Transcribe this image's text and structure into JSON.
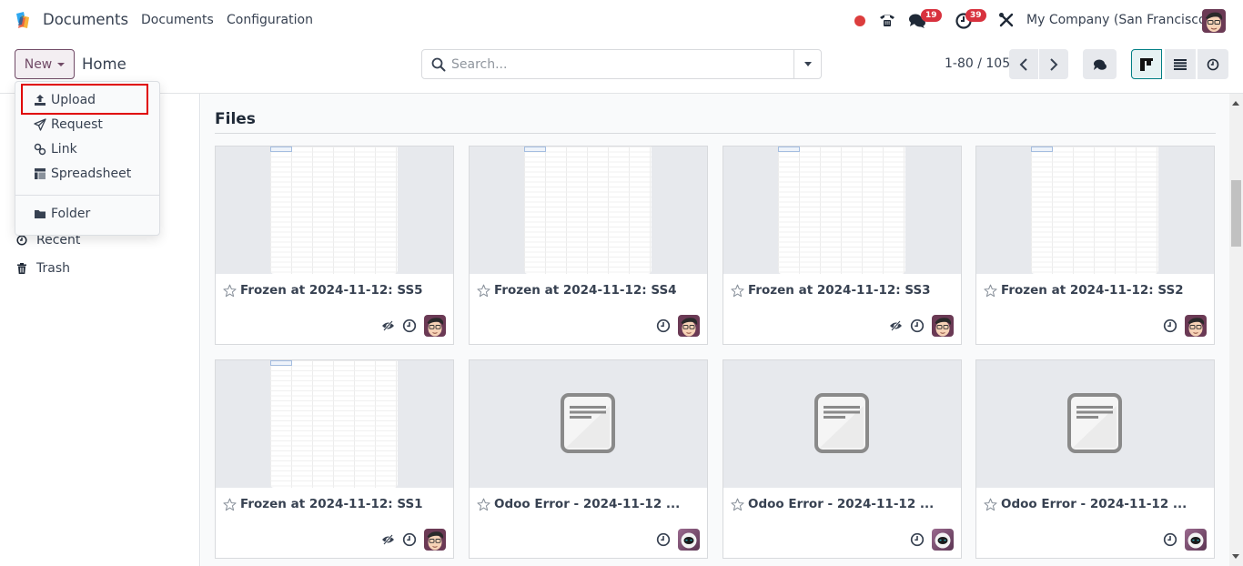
{
  "navbar": {
    "app_name": "Documents",
    "menu": [
      "Documents",
      "Configuration"
    ],
    "messages_badge": "19",
    "activities_badge": "39",
    "company": "My Company (San Francisco)",
    "icons": [
      "recording-dot-icon",
      "phone-icon",
      "chat-icon",
      "clock-icon",
      "tools-icon",
      "user-avatar"
    ]
  },
  "control_panel": {
    "new_button": "New",
    "breadcrumb": "Home",
    "search_placeholder": "Search...",
    "search_value": "",
    "pager": "1-80 / 105",
    "views": [
      "kanban",
      "list",
      "activity"
    ],
    "active_view": "kanban"
  },
  "new_dropdown": {
    "items": [
      {
        "label": "Upload",
        "icon": "upload-icon",
        "highlighted": true
      },
      {
        "label": "Request",
        "icon": "paper-plane-icon"
      },
      {
        "label": "Link",
        "icon": "link-icon"
      },
      {
        "label": "Spreadsheet",
        "icon": "spreadsheet-icon"
      },
      {
        "label": "Folder",
        "icon": "folder-icon"
      }
    ]
  },
  "sidebar": {
    "items": [
      {
        "label": "Recent",
        "icon": "clock-icon"
      },
      {
        "label": "Trash",
        "icon": "trash-icon"
      }
    ]
  },
  "main": {
    "section_title": "Files",
    "cards": [
      {
        "title": "Frozen at 2024-11-12: SS5",
        "preview": "spreadsheet",
        "hidden_icon": true,
        "owner": "user"
      },
      {
        "title": "Frozen at 2024-11-12: SS4",
        "preview": "spreadsheet",
        "hidden_icon": false,
        "owner": "user"
      },
      {
        "title": "Frozen at 2024-11-12: SS3",
        "preview": "spreadsheet",
        "hidden_icon": true,
        "owner": "user"
      },
      {
        "title": "Frozen at 2024-11-12: SS2",
        "preview": "spreadsheet",
        "hidden_icon": false,
        "owner": "user"
      },
      {
        "title": "Frozen at 2024-11-12: SS1",
        "preview": "spreadsheet",
        "hidden_icon": true,
        "owner": "user"
      },
      {
        "title": "Odoo Error - 2024-11-12 ...",
        "preview": "document",
        "hidden_icon": false,
        "owner": "bot"
      },
      {
        "title": "Odoo Error - 2024-11-12 ...",
        "preview": "document",
        "hidden_icon": false,
        "owner": "bot"
      },
      {
        "title": "Odoo Error - 2024-11-12 ...",
        "preview": "document",
        "hidden_icon": false,
        "owner": "bot"
      }
    ]
  },
  "colors": {
    "brand": "#714B67",
    "accent": "#017e84",
    "badge": "#d8323e",
    "highlight": "#e00000"
  }
}
